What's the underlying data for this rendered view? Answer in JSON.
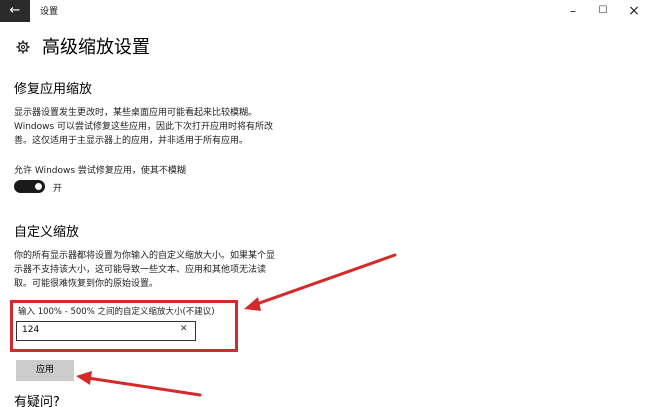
{
  "window": {
    "app_title": "设置",
    "back_icon": "arrow-left-icon",
    "minimize_icon": "minimize-icon",
    "maximize_icon": "maximize-icon",
    "close_icon": "close-icon"
  },
  "page": {
    "home_icon": "gear-icon",
    "title": "高级缩放设置"
  },
  "fix_scaling": {
    "heading": "修复应用缩放",
    "description_lines": [
      "显示器设置发生更改时，某些桌面应用可能看起来比较模糊。",
      "Windows 可以尝试修复这些应用，因此下次打开应用时将有所改",
      "善。这仅适用于主显示器上的应用，并非适用于所有应用。"
    ],
    "toggle_label": "允许 Windows 尝试修复应用，使其不模糊",
    "toggle_on": true,
    "toggle_state_text": "开"
  },
  "custom_scaling": {
    "heading": "自定义缩放",
    "description_lines": [
      "你的所有显示器都将设置为你输入的自定义缩放大小。如果某个显",
      "示器不支持该大小，这可能导致一些文本、应用和其他项无法读",
      "取。可能很难恢复到你的原始设置。"
    ],
    "input_label": "输入 100% - 500% 之间的自定义缩放大小(不建议)",
    "input_value": "124",
    "clear_icon": "close-icon",
    "apply_label": "应用"
  },
  "help": {
    "heading": "有疑问?"
  },
  "annotation": {
    "highlight_color": "#d42a2a",
    "arrow_color": "#d42a2a"
  }
}
